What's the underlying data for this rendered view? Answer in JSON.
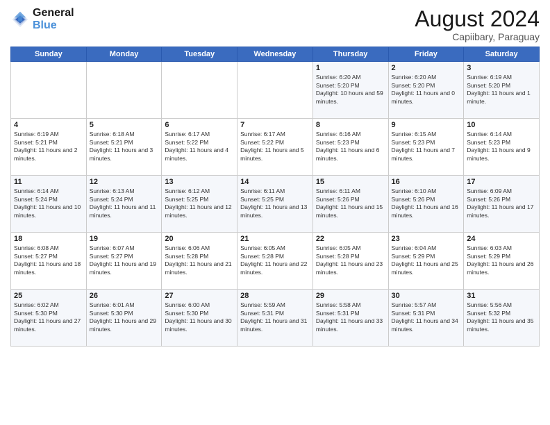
{
  "header": {
    "logo_line1": "General",
    "logo_line2": "Blue",
    "month": "August 2024",
    "location": "Capiibary, Paraguay"
  },
  "days_of_week": [
    "Sunday",
    "Monday",
    "Tuesday",
    "Wednesday",
    "Thursday",
    "Friday",
    "Saturday"
  ],
  "weeks": [
    [
      {
        "day": "",
        "info": ""
      },
      {
        "day": "",
        "info": ""
      },
      {
        "day": "",
        "info": ""
      },
      {
        "day": "",
        "info": ""
      },
      {
        "day": "1",
        "info": "Sunrise: 6:20 AM\nSunset: 5:20 PM\nDaylight: 10 hours and 59 minutes."
      },
      {
        "day": "2",
        "info": "Sunrise: 6:20 AM\nSunset: 5:20 PM\nDaylight: 11 hours and 0 minutes."
      },
      {
        "day": "3",
        "info": "Sunrise: 6:19 AM\nSunset: 5:20 PM\nDaylight: 11 hours and 1 minute."
      }
    ],
    [
      {
        "day": "4",
        "info": "Sunrise: 6:19 AM\nSunset: 5:21 PM\nDaylight: 11 hours and 2 minutes."
      },
      {
        "day": "5",
        "info": "Sunrise: 6:18 AM\nSunset: 5:21 PM\nDaylight: 11 hours and 3 minutes."
      },
      {
        "day": "6",
        "info": "Sunrise: 6:17 AM\nSunset: 5:22 PM\nDaylight: 11 hours and 4 minutes."
      },
      {
        "day": "7",
        "info": "Sunrise: 6:17 AM\nSunset: 5:22 PM\nDaylight: 11 hours and 5 minutes."
      },
      {
        "day": "8",
        "info": "Sunrise: 6:16 AM\nSunset: 5:23 PM\nDaylight: 11 hours and 6 minutes."
      },
      {
        "day": "9",
        "info": "Sunrise: 6:15 AM\nSunset: 5:23 PM\nDaylight: 11 hours and 7 minutes."
      },
      {
        "day": "10",
        "info": "Sunrise: 6:14 AM\nSunset: 5:23 PM\nDaylight: 11 hours and 9 minutes."
      }
    ],
    [
      {
        "day": "11",
        "info": "Sunrise: 6:14 AM\nSunset: 5:24 PM\nDaylight: 11 hours and 10 minutes."
      },
      {
        "day": "12",
        "info": "Sunrise: 6:13 AM\nSunset: 5:24 PM\nDaylight: 11 hours and 11 minutes."
      },
      {
        "day": "13",
        "info": "Sunrise: 6:12 AM\nSunset: 5:25 PM\nDaylight: 11 hours and 12 minutes."
      },
      {
        "day": "14",
        "info": "Sunrise: 6:11 AM\nSunset: 5:25 PM\nDaylight: 11 hours and 13 minutes."
      },
      {
        "day": "15",
        "info": "Sunrise: 6:11 AM\nSunset: 5:26 PM\nDaylight: 11 hours and 15 minutes."
      },
      {
        "day": "16",
        "info": "Sunrise: 6:10 AM\nSunset: 5:26 PM\nDaylight: 11 hours and 16 minutes."
      },
      {
        "day": "17",
        "info": "Sunrise: 6:09 AM\nSunset: 5:26 PM\nDaylight: 11 hours and 17 minutes."
      }
    ],
    [
      {
        "day": "18",
        "info": "Sunrise: 6:08 AM\nSunset: 5:27 PM\nDaylight: 11 hours and 18 minutes."
      },
      {
        "day": "19",
        "info": "Sunrise: 6:07 AM\nSunset: 5:27 PM\nDaylight: 11 hours and 19 minutes."
      },
      {
        "day": "20",
        "info": "Sunrise: 6:06 AM\nSunset: 5:28 PM\nDaylight: 11 hours and 21 minutes."
      },
      {
        "day": "21",
        "info": "Sunrise: 6:05 AM\nSunset: 5:28 PM\nDaylight: 11 hours and 22 minutes."
      },
      {
        "day": "22",
        "info": "Sunrise: 6:05 AM\nSunset: 5:28 PM\nDaylight: 11 hours and 23 minutes."
      },
      {
        "day": "23",
        "info": "Sunrise: 6:04 AM\nSunset: 5:29 PM\nDaylight: 11 hours and 25 minutes."
      },
      {
        "day": "24",
        "info": "Sunrise: 6:03 AM\nSunset: 5:29 PM\nDaylight: 11 hours and 26 minutes."
      }
    ],
    [
      {
        "day": "25",
        "info": "Sunrise: 6:02 AM\nSunset: 5:30 PM\nDaylight: 11 hours and 27 minutes."
      },
      {
        "day": "26",
        "info": "Sunrise: 6:01 AM\nSunset: 5:30 PM\nDaylight: 11 hours and 29 minutes."
      },
      {
        "day": "27",
        "info": "Sunrise: 6:00 AM\nSunset: 5:30 PM\nDaylight: 11 hours and 30 minutes."
      },
      {
        "day": "28",
        "info": "Sunrise: 5:59 AM\nSunset: 5:31 PM\nDaylight: 11 hours and 31 minutes."
      },
      {
        "day": "29",
        "info": "Sunrise: 5:58 AM\nSunset: 5:31 PM\nDaylight: 11 hours and 33 minutes."
      },
      {
        "day": "30",
        "info": "Sunrise: 5:57 AM\nSunset: 5:31 PM\nDaylight: 11 hours and 34 minutes."
      },
      {
        "day": "31",
        "info": "Sunrise: 5:56 AM\nSunset: 5:32 PM\nDaylight: 11 hours and 35 minutes."
      }
    ]
  ]
}
